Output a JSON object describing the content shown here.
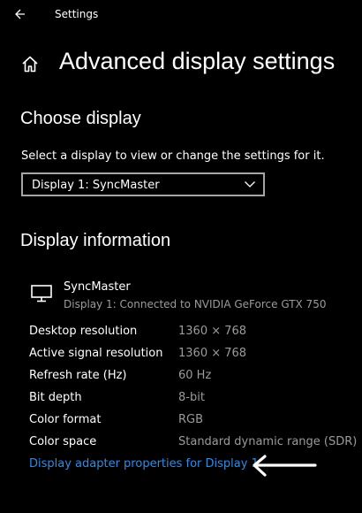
{
  "window": {
    "app_title": "Settings",
    "back_icon": "back-arrow-icon"
  },
  "header": {
    "home_icon": "home-icon",
    "title": "Advanced display settings"
  },
  "choose_display": {
    "title": "Choose display",
    "description": "Select a display to view or change the settings for it.",
    "selected": "Display 1: SyncMaster",
    "dropdown_icon": "chevron-down-icon"
  },
  "display_info": {
    "title": "Display information",
    "monitor_icon": "monitor-icon",
    "monitor_name": "SyncMaster",
    "monitor_connection": "Display 1: Connected to NVIDIA GeForce GTX 750",
    "rows": [
      {
        "label": "Desktop resolution",
        "value": "1360 × 768"
      },
      {
        "label": "Active signal resolution",
        "value": "1360 × 768"
      },
      {
        "label": "Refresh rate (Hz)",
        "value": "60 Hz"
      },
      {
        "label": "Bit depth",
        "value": "8-bit"
      },
      {
        "label": "Color format",
        "value": "RGB"
      },
      {
        "label": "Color space",
        "value": "Standard dynamic range (SDR)"
      }
    ],
    "adapter_link": "Display adapter properties for Display 1"
  },
  "annotation": {
    "icon": "pointer-arrow-icon"
  },
  "colors": {
    "background": "#000000",
    "text": "#ffffff",
    "secondary_text": "#9b9b9b",
    "link": "#2c8ce6",
    "border": "#a6a6a6"
  }
}
